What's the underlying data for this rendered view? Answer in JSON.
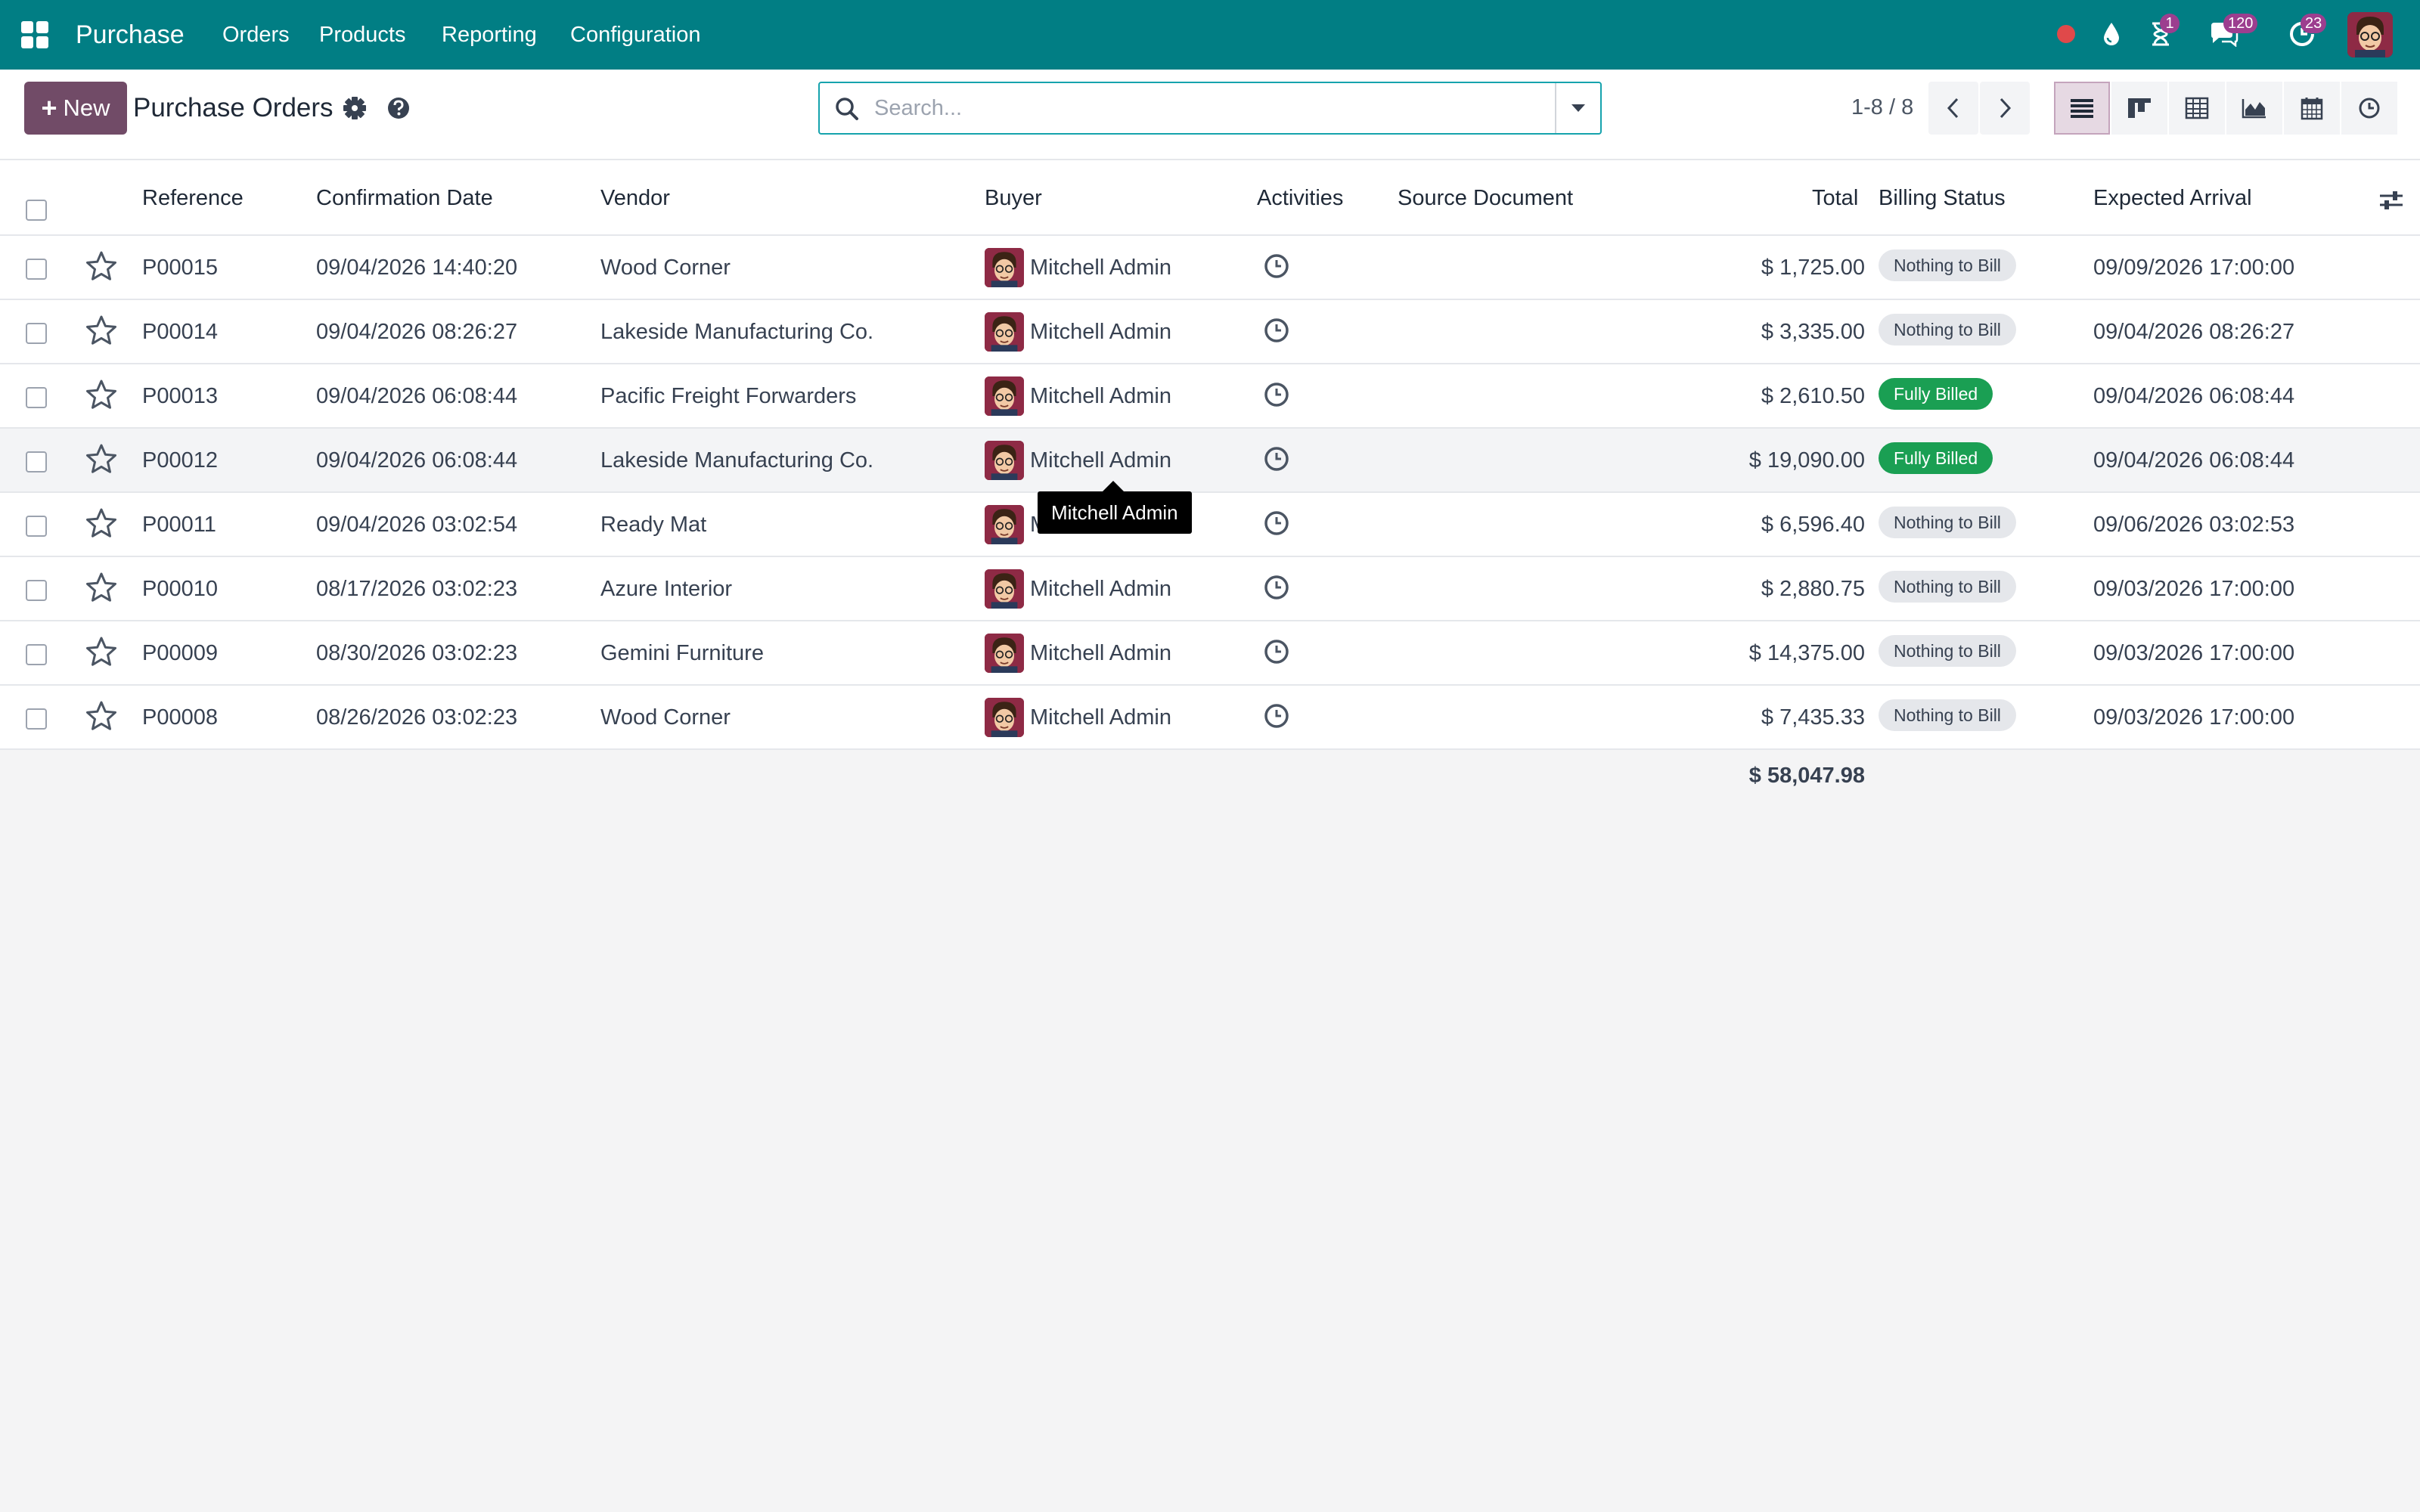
{
  "navbar": {
    "app_name": "Purchase",
    "menu": [
      "Orders",
      "Products",
      "Reporting",
      "Configuration"
    ],
    "activities_count": "1",
    "messages_count": "120",
    "timeoff_count": "23",
    "record_dot_color": "#e0494a",
    "color": "#017e84"
  },
  "control": {
    "new_label": "New",
    "title": "Purchase Orders",
    "search_placeholder": "Search...",
    "pager": "1-8 / 8",
    "views": [
      "list-view-icon",
      "kanban-view-icon",
      "pivot-view-icon",
      "graph-view-icon",
      "calendar-view-icon",
      "activity-view-icon"
    ],
    "active_view": "list"
  },
  "table": {
    "headers": {
      "reference": "Reference",
      "confirmation_date": "Confirmation Date",
      "vendor": "Vendor",
      "buyer": "Buyer",
      "activities": "Activities",
      "source_document": "Source Document",
      "total": "Total",
      "billing_status": "Billing Status",
      "expected_arrival": "Expected Arrival"
    },
    "rows": [
      {
        "reference": "P00015",
        "confirmation_date": "09/04/2026 14:40:20",
        "vendor": "Wood Corner",
        "buyer": "Mitchell Admin",
        "total": "$ 1,725.00",
        "billing_status": "Nothing to Bill",
        "expected_arrival": "09/09/2026 17:00:00"
      },
      {
        "reference": "P00014",
        "confirmation_date": "09/04/2026 08:26:27",
        "vendor": "Lakeside Manufacturing Co.",
        "buyer": "Mitchell Admin",
        "total": "$ 3,335.00",
        "billing_status": "Nothing to Bill",
        "expected_arrival": "09/04/2026 08:26:27"
      },
      {
        "reference": "P00013",
        "confirmation_date": "09/04/2026 06:08:44",
        "vendor": "Pacific Freight Forwarders",
        "buyer": "Mitchell Admin",
        "total": "$ 2,610.50",
        "billing_status": "Fully Billed",
        "expected_arrival": "09/04/2026 06:08:44"
      },
      {
        "reference": "P00012",
        "confirmation_date": "09/04/2026 06:08:44",
        "vendor": "Lakeside Manufacturing Co.",
        "buyer": "Mitchell Admin",
        "total": "$ 19,090.00",
        "billing_status": "Fully Billed",
        "expected_arrival": "09/04/2026 06:08:44"
      },
      {
        "reference": "P00011",
        "confirmation_date": "09/04/2026 03:02:54",
        "vendor": "Ready Mat",
        "buyer": "M",
        "total": "$ 6,596.40",
        "billing_status": "Nothing to Bill",
        "expected_arrival": "09/06/2026 03:02:53"
      },
      {
        "reference": "P00010",
        "confirmation_date": "08/17/2026 03:02:23",
        "vendor": "Azure Interior",
        "buyer": "Mitchell Admin",
        "total": "$ 2,880.75",
        "billing_status": "Nothing to Bill",
        "expected_arrival": "09/03/2026 17:00:00"
      },
      {
        "reference": "P00009",
        "confirmation_date": "08/30/2026 03:02:23",
        "vendor": "Gemini Furniture",
        "buyer": "Mitchell Admin",
        "total": "$ 14,375.00",
        "billing_status": "Nothing to Bill",
        "expected_arrival": "09/03/2026 17:00:00"
      },
      {
        "reference": "P00008",
        "confirmation_date": "08/26/2026 03:02:23",
        "vendor": "Wood Corner",
        "buyer": "Mitchell Admin",
        "total": "$ 7,435.33",
        "billing_status": "Nothing to Bill",
        "expected_arrival": "09/03/2026 17:00:00"
      }
    ],
    "grand_total": "$ 58,047.98",
    "status_colors": {
      "Nothing to Bill": "#e5e7eb",
      "Fully Billed": "#1a9f53"
    }
  },
  "tooltip": {
    "text": "Mitchell Admin"
  }
}
